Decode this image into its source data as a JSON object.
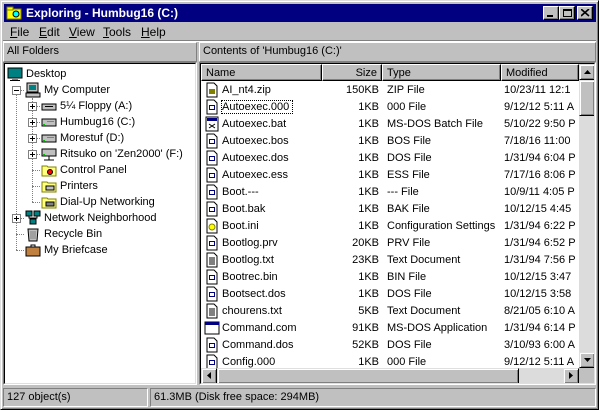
{
  "window": {
    "title": "Exploring - Humbug16 (C:)",
    "title_bar_color": "#000080"
  },
  "menu": [
    {
      "label": "File",
      "key": "F",
      "rest": "ile"
    },
    {
      "label": "Edit",
      "key": "E",
      "rest": "dit"
    },
    {
      "label": "View",
      "key": "V",
      "rest": "iew"
    },
    {
      "label": "Tools",
      "key": "T",
      "rest": "ools"
    },
    {
      "label": "Help",
      "key": "H",
      "rest": "elp"
    }
  ],
  "left_pane": {
    "label": "All Folders",
    "tree": [
      {
        "label": "Desktop",
        "icon": "desktop-icon",
        "expander": "none"
      },
      {
        "label": "My Computer",
        "icon": "computer-icon",
        "expander": "minus"
      },
      {
        "label": "5¼ Floppy (A:)",
        "icon": "floppy-drive-icon",
        "expander": "plus"
      },
      {
        "label": "Humbug16 (C:)",
        "icon": "hard-drive-icon",
        "expander": "plus"
      },
      {
        "label": "Morestuf (D:)",
        "icon": "hard-drive-icon",
        "expander": "plus"
      },
      {
        "label": "Ritsuko on 'Zen2000' (F:)",
        "icon": "network-drive-icon",
        "expander": "plus"
      },
      {
        "label": "Control Panel",
        "icon": "control-panel-folder-icon",
        "expander": "none"
      },
      {
        "label": "Printers",
        "icon": "printers-folder-icon",
        "expander": "none"
      },
      {
        "label": "Dial-Up Networking",
        "icon": "dialup-folder-icon",
        "expander": "none"
      },
      {
        "label": "Network Neighborhood",
        "icon": "network-icon",
        "expander": "plus"
      },
      {
        "label": "Recycle Bin",
        "icon": "recycle-bin-icon",
        "expander": "none"
      },
      {
        "label": "My Briefcase",
        "icon": "briefcase-icon",
        "expander": "none"
      }
    ]
  },
  "right_pane": {
    "label": "Contents of 'Humbug16 (C:)'",
    "columns": [
      "Name",
      "Size",
      "Type",
      "Modified"
    ],
    "files": [
      {
        "name": "AI_nt4.zip",
        "size": "150KB",
        "type": "ZIP File",
        "modified": "10/23/11 12:1",
        "icon": "zip-file-icon"
      },
      {
        "name": "Autoexec.000",
        "size": "1KB",
        "type": "000 File",
        "modified": "9/12/12 5:11 A",
        "icon": "generic-file-icon"
      },
      {
        "name": "Autoexec.bat",
        "size": "1KB",
        "type": "MS-DOS Batch File",
        "modified": "5/10/22 9:50 P",
        "icon": "batch-file-icon"
      },
      {
        "name": "Autoexec.bos",
        "size": "1KB",
        "type": "BOS File",
        "modified": "7/18/16 11:00",
        "icon": "generic-file-icon"
      },
      {
        "name": "Autoexec.dos",
        "size": "1KB",
        "type": "DOS File",
        "modified": "1/31/94 6:04 P",
        "icon": "generic-file-icon"
      },
      {
        "name": "Autoexec.ess",
        "size": "1KB",
        "type": "ESS File",
        "modified": "7/17/16 8:06 P",
        "icon": "generic-file-icon"
      },
      {
        "name": "Boot.---",
        "size": "1KB",
        "type": "--- File",
        "modified": "10/9/11 4:05 P",
        "icon": "generic-file-icon"
      },
      {
        "name": "Boot.bak",
        "size": "1KB",
        "type": "BAK File",
        "modified": "10/12/15 4:45",
        "icon": "generic-file-icon"
      },
      {
        "name": "Boot.ini",
        "size": "1KB",
        "type": "Configuration Settings",
        "modified": "1/31/94 6:22 P",
        "icon": "config-file-icon"
      },
      {
        "name": "Bootlog.prv",
        "size": "20KB",
        "type": "PRV File",
        "modified": "1/31/94 6:52 P",
        "icon": "generic-file-icon"
      },
      {
        "name": "Bootlog.txt",
        "size": "23KB",
        "type": "Text Document",
        "modified": "1/31/94 7:56 P",
        "icon": "text-file-icon"
      },
      {
        "name": "Bootrec.bin",
        "size": "1KB",
        "type": "BIN File",
        "modified": "10/12/15 3:47",
        "icon": "generic-file-icon"
      },
      {
        "name": "Bootsect.dos",
        "size": "1KB",
        "type": "DOS File",
        "modified": "10/12/15 3:58",
        "icon": "generic-file-icon"
      },
      {
        "name": "chourens.txt",
        "size": "5KB",
        "type": "Text Document",
        "modified": "8/21/05 6:10 A",
        "icon": "text-file-icon"
      },
      {
        "name": "Command.com",
        "size": "91KB",
        "type": "MS-DOS Application",
        "modified": "1/31/94 6:14 P",
        "icon": "dos-app-icon"
      },
      {
        "name": "Command.dos",
        "size": "52KB",
        "type": "DOS File",
        "modified": "3/10/93 6:00 A",
        "icon": "generic-file-icon"
      },
      {
        "name": "Config.000",
        "size": "1KB",
        "type": "000 File",
        "modified": "9/12/12 5:11 A",
        "icon": "generic-file-icon"
      }
    ]
  },
  "status": {
    "objects": "127 object(s)",
    "disk": "61.3MB (Disk free space: 294MB)"
  }
}
